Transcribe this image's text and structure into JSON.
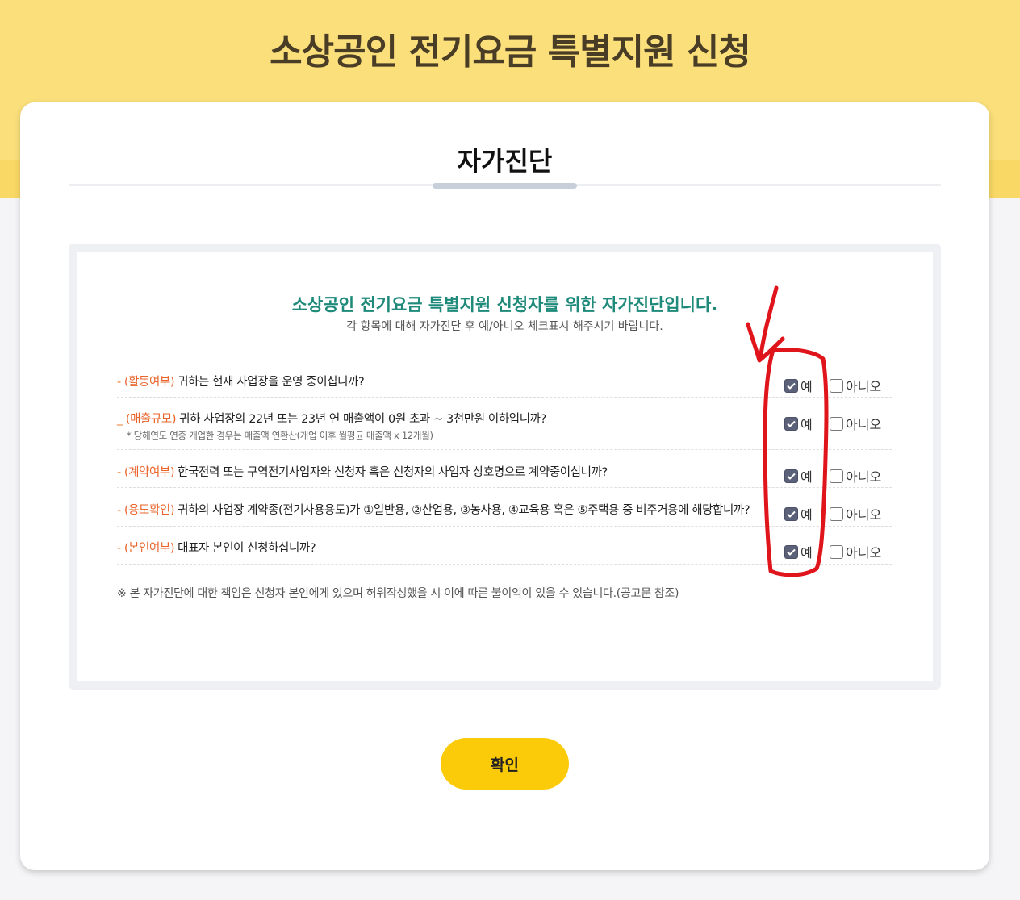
{
  "header": {
    "title": "소상공인 전기요금 특별지원 신청"
  },
  "section": {
    "title": "자가진단"
  },
  "intro": {
    "title": "소상공인 전기요금 특별지원 신청자를 위한 자가진단입니다.",
    "subtitle": "각 항목에 대해 자가진단 후 예/아니오 체크표시 해주시기 바랍니다."
  },
  "questions": [
    {
      "dash": "-",
      "tag": "(활동여부)",
      "text": "귀하는 현재 사업장을 운영 중이십니까?",
      "note": "",
      "answer": "yes"
    },
    {
      "dash": "_",
      "tag": "(매출규모)",
      "text": "귀하 사업장의 22년 또는 23년 연 매출액이 0원 초과 ~ 3천만원 이하입니까?",
      "note": "* 당해연도 연중 개업한 경우는 매출액 연환산(개업 이후 월평균 매출액 x 12개월)",
      "answer": "yes"
    },
    {
      "dash": "-",
      "tag": "(계약여부)",
      "text": "한국전력 또는 구역전기사업자와 신청자 혹은 신청자의 사업자 상호명으로 계약중이십니까?",
      "note": "",
      "answer": "yes"
    },
    {
      "dash": "-",
      "tag": "(용도확인)",
      "text": "귀하의 사업장 계약종(전기사용용도)가 ①일반용, ②산업용, ③농사용, ④교육용 혹은 ⑤주택용 중 비주거용에 해당합니까?",
      "note": "",
      "answer": "yes"
    },
    {
      "dash": "-",
      "tag": "(본인여부)",
      "text": "대표자 본인이 신청하십니까?",
      "note": "",
      "answer": "yes"
    }
  ],
  "options": {
    "yes": "예",
    "no": "아니오"
  },
  "disclaimer": "※ 본 자가진단에 대한 책임은 신청자 본인에게 있으며 허위작성했을 시 이에 따른 불이익이 있을 수 있습니다.(공고문 참조)",
  "confirm_button": "확인",
  "colors": {
    "header_band": "#fadf7b",
    "accent_tag": "#e9632a",
    "intro_title": "#1f8a7a",
    "button": "#fbcb0a",
    "annotation": "#e0141b"
  }
}
